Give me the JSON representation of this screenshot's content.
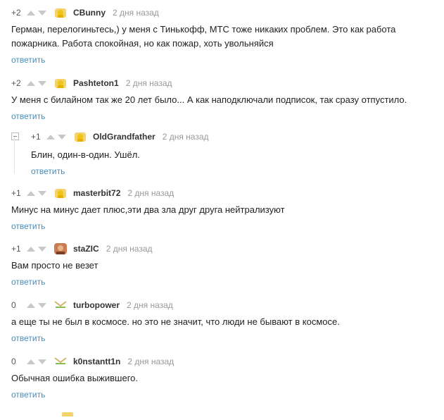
{
  "reply_label": "ответить",
  "comments": [
    {
      "rating": "+2",
      "author": "CBunny",
      "time": "2 дня назад",
      "text": [
        "Герман, перелогиньтесь,) у меня с Тинькофф, МТС тоже никаких проблем. Это как работа",
        "пожарника. Работа спокойная, но как пожар, хоть увольняйся"
      ]
    },
    {
      "rating": "+2",
      "author": "Pashteton1",
      "time": "2 дня назад",
      "text": [
        "У меня с билайном так же 20 лет было... А как наподключали подписок, так сразу отпустило."
      ]
    },
    {
      "rating": "+1",
      "author": "OldGrandfather",
      "time": "2 дня назад",
      "text": [
        "Блин, один-в-один. Ушёл."
      ]
    },
    {
      "rating": "+1",
      "author": "masterbit72",
      "time": "2 дня назад",
      "text": [
        "Минус на минус дает плюс,эти два зла друг друга нейтрализуют"
      ]
    },
    {
      "rating": "+1",
      "author": "staZIC",
      "time": "2 дня назад",
      "text": [
        "Вам просто не везет"
      ]
    },
    {
      "rating": "0",
      "author": "turbopower",
      "time": "2 дня назад",
      "text": [
        "а еще ты не был в космосе. но это не значит, что люди не бывают в космосе."
      ]
    },
    {
      "rating": "0",
      "author": "k0nstantt1n",
      "time": "2 дня назад",
      "text": [
        "Обычная ошибка выжившего."
      ]
    }
  ],
  "colors": {
    "link": "#3c8fc9",
    "arrow": "#c8c8c8",
    "avatar_default": "#f0c419"
  }
}
